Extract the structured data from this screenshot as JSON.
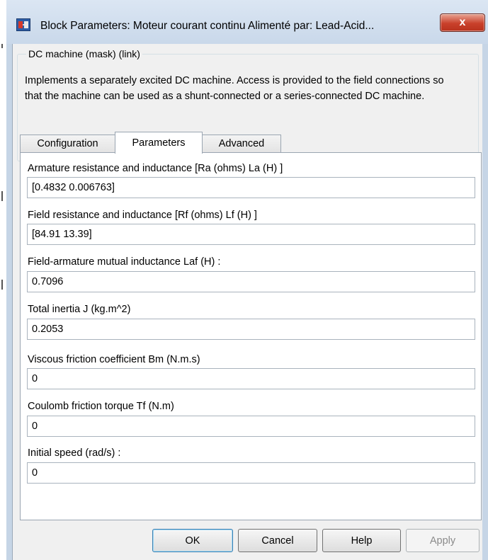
{
  "window": {
    "title": "Block Parameters: Moteur courant continu Alimenté par: Lead-Acid...",
    "close_glyph": "x"
  },
  "mask": {
    "group_title": "DC machine (mask) (link)",
    "description": "Implements a separately excited DC machine. Access is provided  to the field connections so that the machine can be used as a shunt-connected or a series-connected  DC machine."
  },
  "tabs": [
    {
      "label": "Configuration",
      "active": false
    },
    {
      "label": "Parameters",
      "active": true
    },
    {
      "label": "Advanced",
      "active": false
    }
  ],
  "parameters": [
    {
      "label": "Armature resistance and inductance [Ra (ohms) La (H) ]",
      "value": "[0.4832 0.006763]"
    },
    {
      "label": "Field resistance and inductance [Rf (ohms) Lf (H) ]",
      "value": "[84.91 13.39]"
    },
    {
      "label": "Field-armature mutual inductance Laf (H) :",
      "value": "0.7096"
    },
    {
      "label": "Total inertia J (kg.m^2)",
      "value": "0.2053"
    },
    {
      "label": "Viscous friction coefficient Bm (N.m.s)",
      "value": "0"
    },
    {
      "label": "Coulomb friction torque Tf (N.m)",
      "value": "0"
    },
    {
      "label": "Initial speed (rad/s) :",
      "value": "0"
    }
  ],
  "buttons": {
    "ok": "OK",
    "cancel": "Cancel",
    "help": "Help",
    "apply": "Apply"
  },
  "colors": {
    "title_bar": "#c9d8ea",
    "close_button": "#c9402b",
    "default_button_border": "#3c7fb1"
  },
  "icons": {
    "app": "simulink-block-icon",
    "close": "close-icon"
  }
}
